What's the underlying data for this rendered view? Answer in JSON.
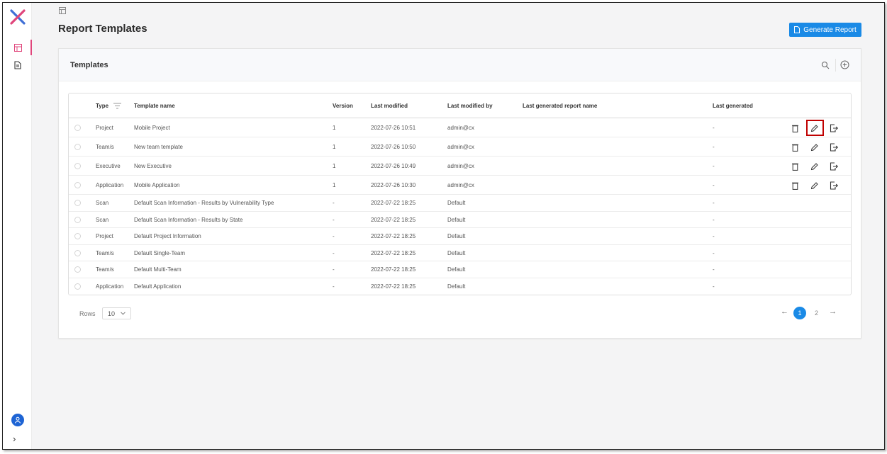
{
  "page": {
    "title": "Report Templates",
    "generate_button": "Generate Report"
  },
  "card": {
    "title": "Templates"
  },
  "table": {
    "headers": {
      "type": "Type",
      "template_name": "Template name",
      "version": "Version",
      "last_modified": "Last modified",
      "last_modified_by": "Last modified by",
      "last_generated_report_name": "Last generated report name",
      "last_generated": "Last generated"
    },
    "rows": [
      {
        "type": "Project",
        "name": "Mobile Project",
        "version": "1",
        "modified": "2022-07-26 10:51",
        "by": "admin@cx",
        "report": "",
        "generated": "-",
        "actions": true
      },
      {
        "type": "Team/s",
        "name": "New team template",
        "version": "1",
        "modified": "2022-07-26 10:50",
        "by": "admin@cx",
        "report": "",
        "generated": "-",
        "actions": true
      },
      {
        "type": "Executive",
        "name": "New Executive",
        "version": "1",
        "modified": "2022-07-26 10:49",
        "by": "admin@cx",
        "report": "",
        "generated": "-",
        "actions": true
      },
      {
        "type": "Application",
        "name": "Mobile Application",
        "version": "1",
        "modified": "2022-07-26 10:30",
        "by": "admin@cx",
        "report": "",
        "generated": "-",
        "actions": true
      },
      {
        "type": "Scan",
        "name": "Default Scan Information - Results by Vulnerability Type",
        "version": "-",
        "modified": "2022-07-22 18:25",
        "by": "Default",
        "report": "",
        "generated": "-",
        "actions": false
      },
      {
        "type": "Scan",
        "name": "Default Scan Information - Results by State",
        "version": "-",
        "modified": "2022-07-22 18:25",
        "by": "Default",
        "report": "",
        "generated": "-",
        "actions": false
      },
      {
        "type": "Project",
        "name": "Default Project Information",
        "version": "-",
        "modified": "2022-07-22 18:25",
        "by": "Default",
        "report": "",
        "generated": "-",
        "actions": false
      },
      {
        "type": "Team/s",
        "name": "Default Single-Team",
        "version": "-",
        "modified": "2022-07-22 18:25",
        "by": "Default",
        "report": "",
        "generated": "-",
        "actions": false
      },
      {
        "type": "Team/s",
        "name": "Default Multi-Team",
        "version": "-",
        "modified": "2022-07-22 18:25",
        "by": "Default",
        "report": "",
        "generated": "-",
        "actions": false
      },
      {
        "type": "Application",
        "name": "Default Application",
        "version": "-",
        "modified": "2022-07-22 18:25",
        "by": "Default",
        "report": "",
        "generated": "-",
        "actions": false
      }
    ]
  },
  "footer": {
    "rows_label": "Rows",
    "rows_value": "10",
    "pages": [
      "1",
      "2"
    ],
    "current_page": "1"
  },
  "colors": {
    "accent": "#1a8ae6",
    "highlight": "#c00000",
    "logo_red": "#e0457b",
    "logo_blue": "#3f6fd6"
  }
}
